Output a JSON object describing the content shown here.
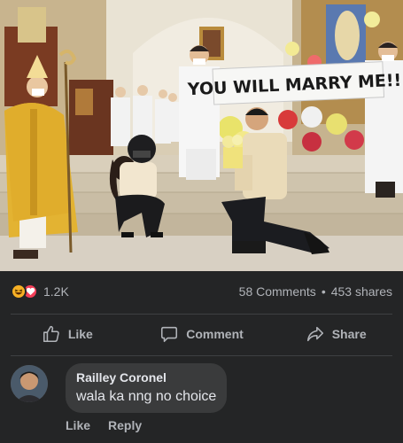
{
  "post": {
    "banner_text": "YOU WILL MARRY ME!!!"
  },
  "stats": {
    "reaction_count": "1.2K",
    "comments": "58 Comments",
    "separator": "•",
    "shares": "453 shares",
    "reactions": [
      "haha-icon",
      "love-icon"
    ]
  },
  "actions": {
    "like": "Like",
    "comment": "Comment",
    "share": "Share"
  },
  "comment": {
    "author": "Railley Coronel",
    "text": "wala ka nng no choice",
    "like": "Like",
    "reply": "Reply"
  },
  "colors": {
    "background": "#242526",
    "bubble": "#3a3b3c",
    "secondary_text": "#b0b3b8",
    "haha": "#f7b125",
    "love": "#f33e58"
  }
}
